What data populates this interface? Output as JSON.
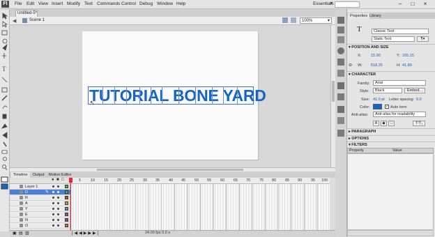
{
  "app": {
    "logo": "Fl",
    "workspace": "Essentials"
  },
  "menu": [
    "File",
    "Edit",
    "View",
    "Insert",
    "Modify",
    "Text",
    "Commands",
    "Control",
    "Debug",
    "Window",
    "Help"
  ],
  "window_buttons": [
    "–",
    "□",
    "×"
  ],
  "document": {
    "tab": "Untitled-5*",
    "scene": "Scene 1",
    "zoom": "100%"
  },
  "stage_text": "TUTORIAL BONE YARD",
  "timeline": {
    "tabs": [
      "Timeline",
      "Output",
      "Motion Editor"
    ],
    "ruler": [
      "5",
      "10",
      "15",
      "20",
      "25",
      "30",
      "35",
      "40",
      "45",
      "50",
      "55",
      "60",
      "65",
      "70",
      "75",
      "80",
      "85",
      "90",
      "95",
      "100"
    ],
    "layers": [
      {
        "name": "Layer 1",
        "color": "#3fbf3f",
        "selected": false
      },
      {
        "name": "D",
        "color": "#3fbf3f",
        "selected": true
      },
      {
        "name": "R",
        "color": "#c94a4a",
        "selected": false
      },
      {
        "name": "A",
        "color": "#c9a12a",
        "selected": false
      },
      {
        "name": "Y",
        "color": "#4aa4c9",
        "selected": false
      },
      {
        "name": "E",
        "color": "#a44ac9",
        "selected": false
      },
      {
        "name": "N",
        "color": "#6a6a6a",
        "selected": false
      },
      {
        "name": "O",
        "color": "#c97a2a",
        "selected": false
      }
    ],
    "status": "24.00 fps  0.0 s"
  },
  "properties": {
    "tabs": [
      "Properties",
      "Library"
    ],
    "text_engine": "Classic Text",
    "text_type": "Static Text",
    "position_size": {
      "title": "POSITION AND SIZE",
      "x_label": "X:",
      "x": "15.90",
      "y_label": "Y:",
      "y": "165.15",
      "w_label": "W:",
      "w": "518.25",
      "h_label": "H:",
      "h": "41.80"
    },
    "character": {
      "title": "CHARACTER",
      "family_label": "Family:",
      "family": "Arial",
      "style_label": "Style:",
      "style": "Black",
      "embed": "Embed...",
      "size_label": "Size:",
      "size": "41.0 pt",
      "spacing_label": "Letter spacing:",
      "spacing": "0.0",
      "color_label": "Color:",
      "color": "#1565c8",
      "autokern": "Auto kern",
      "antialias_label": "Anti-alias:",
      "antialias": "Anti-alias for readability"
    },
    "collapsed": [
      "PARAGRAPH",
      "OPTIONS",
      "FILTERS"
    ],
    "filters_headers": [
      "Property",
      "Value"
    ]
  }
}
